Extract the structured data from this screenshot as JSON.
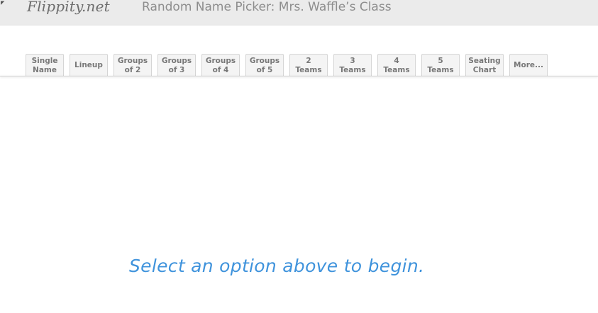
{
  "header": {
    "brand": "Flippity.net",
    "title": "Random Name Picker: Mrs. Waffle’s Class"
  },
  "tabs": [
    {
      "label": "Single\nName"
    },
    {
      "label": "Lineup"
    },
    {
      "label": "Groups\nof 2"
    },
    {
      "label": "Groups\nof 3"
    },
    {
      "label": "Groups\nof 4"
    },
    {
      "label": "Groups\nof 5"
    },
    {
      "label": "2\nTeams"
    },
    {
      "label": "3\nTeams"
    },
    {
      "label": "4\nTeams"
    },
    {
      "label": "5\nTeams"
    },
    {
      "label": "Seating\nChart"
    },
    {
      "label": "More..."
    }
  ],
  "main": {
    "prompt": "Select an option above to begin."
  },
  "colors": {
    "header_bg": "#ebebeb",
    "tab_bg": "#f4f4f4",
    "prompt": "#3f93dc"
  }
}
